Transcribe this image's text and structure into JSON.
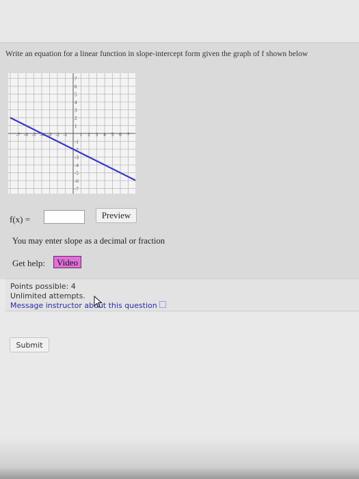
{
  "question": {
    "prompt": "Write an equation for a linear function in slope-intercept form given the graph of f shown below",
    "answer_label": "f(x) =",
    "answer_value": "",
    "preview_label": "Preview",
    "hint": "You may enter slope as a decimal or fraction",
    "get_help_label": "Get help:",
    "video_label": "Video"
  },
  "graph": {
    "x_ticks": [
      "-7",
      "-6",
      "-5",
      "-4",
      "-3",
      "-2",
      "-1",
      "1",
      "2",
      "3",
      "4",
      "5",
      "6",
      "7"
    ],
    "y_ticks": [
      "7",
      "6",
      "5",
      "4",
      "3",
      "2",
      "1",
      "-1",
      "-2",
      "-3",
      "-4",
      "-5",
      "-6",
      "-7"
    ],
    "line_color": "#3a36c8"
  },
  "info": {
    "points": "Points possible: 4",
    "attempts": "Unlimited attempts.",
    "message_link": "Message instructor about this question"
  },
  "footer": {
    "submit_label": "Submit"
  }
}
